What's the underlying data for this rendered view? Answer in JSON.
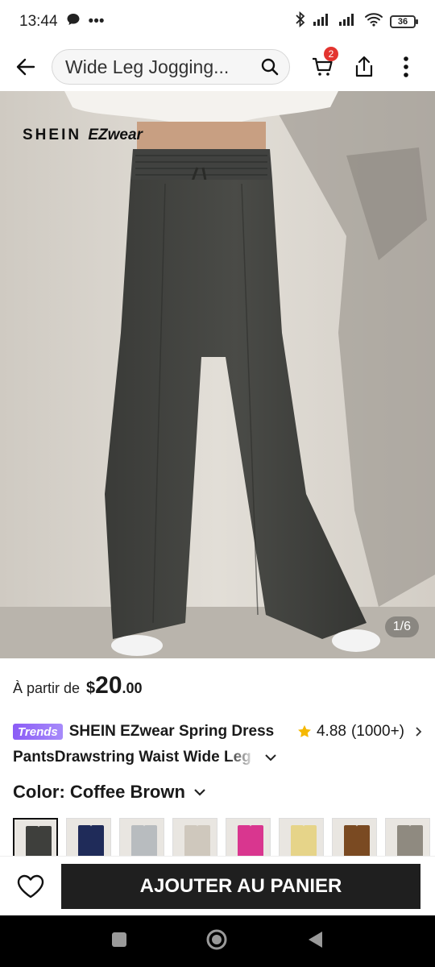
{
  "status_bar": {
    "time": "13:44",
    "dots": "•••",
    "battery": "36"
  },
  "header": {
    "search_text": "Wide Leg Jogging...",
    "cart_count": "2"
  },
  "product_image": {
    "brand_main": "SHEIN",
    "brand_sub": "EZwear",
    "counter": "1/6"
  },
  "price": {
    "prefix": "À partir de",
    "currency": "$",
    "main": "20",
    "cents": ".00"
  },
  "title": {
    "badge": "Trends",
    "line1": "SHEIN EZwear Spring Dress",
    "line2": "PantsDrawstring Waist Wide Leg",
    "rating_value": "4.88",
    "rating_count": "(1000+)"
  },
  "color": {
    "label": "Color: Coffee Brown",
    "swatches": [
      {
        "name": "dark-grey",
        "color": "#3e3f3c"
      },
      {
        "name": "navy",
        "color": "#1f2b59"
      },
      {
        "name": "light-grey",
        "color": "#b8bcbf"
      },
      {
        "name": "beige",
        "color": "#cfc8bd"
      },
      {
        "name": "pink",
        "color": "#d9368f"
      },
      {
        "name": "yellow",
        "color": "#e6d489"
      },
      {
        "name": "coffee-brown",
        "color": "#7a4a22"
      },
      {
        "name": "taupe",
        "color": "#8f8a80"
      }
    ]
  },
  "actions": {
    "add_to_cart": "AJOUTER AU PANIER"
  },
  "colors": {
    "accent_badge": "#e3342f",
    "button_dark": "#1f1f1f",
    "star": "#f5b800",
    "trends_purple": "#8b5cf6"
  }
}
